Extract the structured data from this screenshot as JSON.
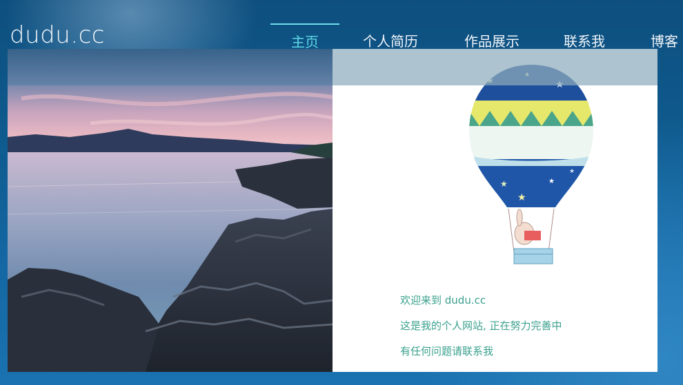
{
  "site": {
    "logo": "dudu.cc"
  },
  "nav": {
    "items": [
      {
        "label": "主页",
        "active": true
      },
      {
        "label": "个人简历",
        "active": false
      },
      {
        "label": "作品展示",
        "active": false
      },
      {
        "label": "联系我",
        "active": false
      },
      {
        "label": "博客",
        "active": false
      }
    ]
  },
  "hero": {
    "welcome_lines": [
      "欢迎来到 dudu.cc",
      "这是我的个人网站, 正在努力完善中",
      "有任何问题请联系我"
    ]
  },
  "colors": {
    "accent": "#5fd6e6",
    "text_green": "#3aa08e",
    "background": "#0f5c91"
  }
}
